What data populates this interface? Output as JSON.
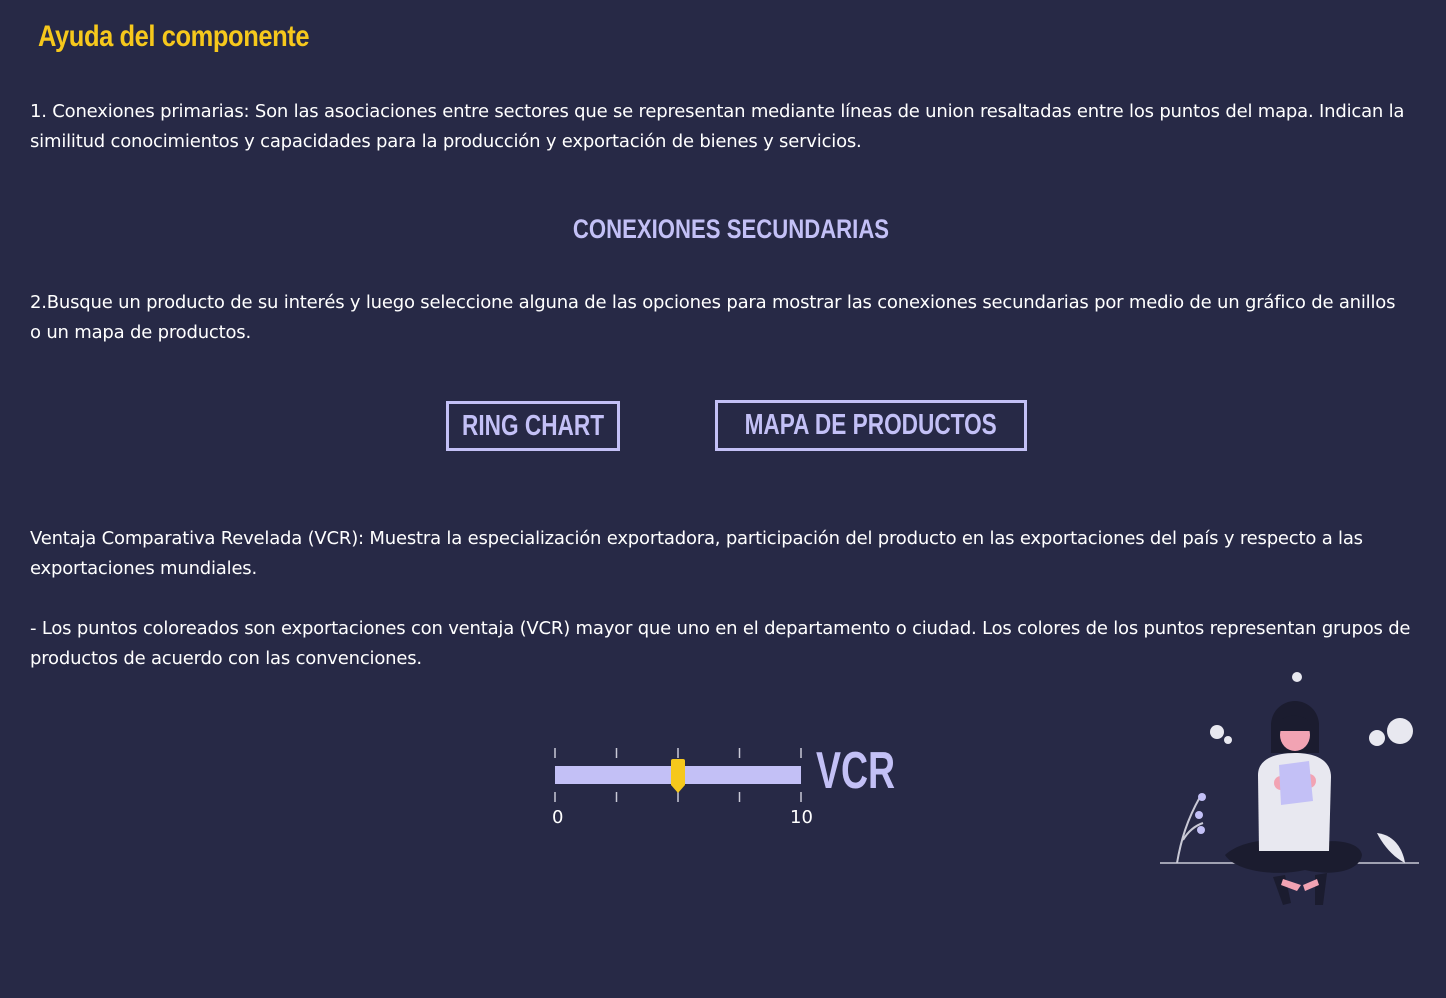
{
  "page": {
    "title": "Ayuda del componente"
  },
  "primary": {
    "text": "1. Conexiones primarias: Son las asociaciones entre sectores que se representan mediante líneas de union resaltadas entre los puntos del mapa. Indican la similitud conocimientos y capacidades para la producción y exportación de bienes y servicios."
  },
  "secondary": {
    "heading": "CONEXIONES SECUNDARIAS",
    "text": "2.Busque un producto de su interés y luego seleccione alguna de las opciones para mostrar las conexiones secundarias por medio de un gráfico de anillos o un mapa de productos.",
    "ring_button_label": "RING CHART",
    "map_button_label": "MAPA DE PRODUCTOS"
  },
  "vcr": {
    "definition": "Ventaja Comparativa Revelada (VCR): Muestra la especialización exportadora, participación del producto en las exportaciones del país y respecto a las exportaciones mundiales.",
    "note": "- Los puntos coloreados son exportaciones con ventaja (VCR) mayor que uno en el departamento o ciudad. Los colores de los puntos representan grupos de productos de acuerdo con las convenciones.",
    "legend": {
      "label": "VCR",
      "min_label": "0",
      "max_label": "10",
      "min": 0,
      "max": 10,
      "marker_value": 5,
      "track_color": "#c3c0f6",
      "marker_color": "#f6c81c"
    }
  },
  "colors": {
    "background": "#272946",
    "title": "#f6c81c",
    "accent": "#c3c0f6",
    "text": "#ffffff"
  },
  "illustration": {
    "icon": "person-reading-illustration"
  }
}
